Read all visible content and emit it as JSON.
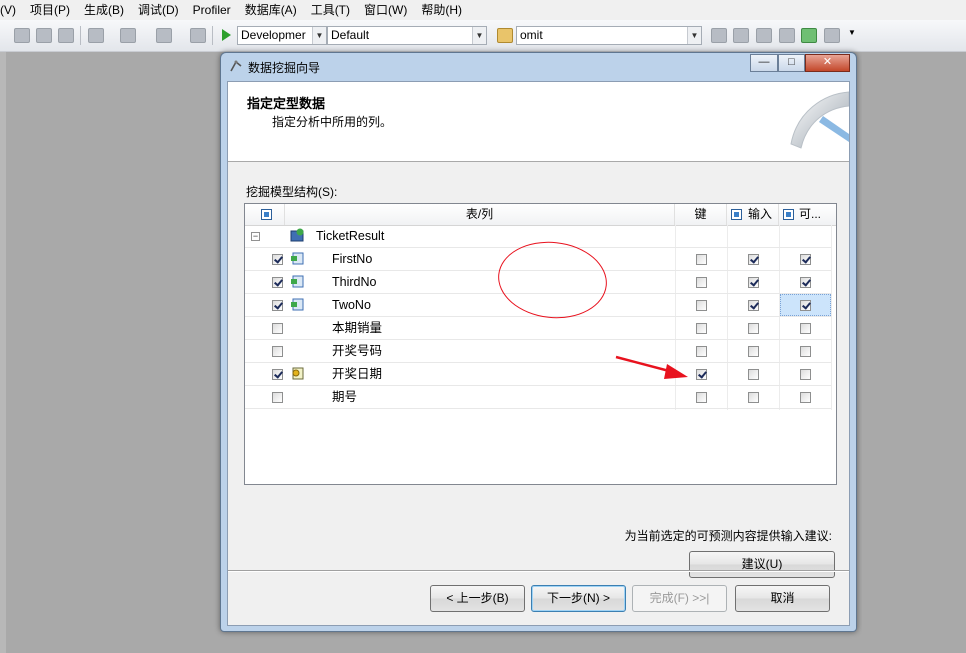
{
  "menu": [
    "(V)",
    "项目(P)",
    "生成(B)",
    "调试(D)",
    "Profiler",
    "数据库(A)",
    "工具(T)",
    "窗口(W)",
    "帮助(H)"
  ],
  "toolbar": {
    "config_combo": "Developmer",
    "platform_combo": "Default",
    "find_combo": "omit"
  },
  "dialog": {
    "title": "数据挖掘向导",
    "header_title": "指定定型数据",
    "header_subtitle": "指定分析中所用的列。",
    "structure_label": "挖掘模型结构(S):",
    "grid": {
      "columns": [
        "表/列",
        "键",
        "输入",
        "可..."
      ],
      "root": "TicketResult",
      "rows": [
        {
          "name": "FirstNo",
          "include": true,
          "icon": "numeric-column-icon",
          "key": false,
          "input": true,
          "predict": true
        },
        {
          "name": "ThirdNo",
          "include": true,
          "icon": "numeric-column-icon",
          "key": false,
          "input": true,
          "predict": true
        },
        {
          "name": "TwoNo",
          "include": true,
          "icon": "numeric-column-icon",
          "key": false,
          "input": true,
          "predict": true
        },
        {
          "name": "本期销量",
          "include": false,
          "icon": "",
          "key": false,
          "input": false,
          "predict": false
        },
        {
          "name": "开奖号码",
          "include": false,
          "icon": "",
          "key": false,
          "input": false,
          "predict": false
        },
        {
          "name": "开奖日期",
          "include": true,
          "icon": "date-key-column-icon",
          "key": true,
          "input": false,
          "predict": false
        },
        {
          "name": "期号",
          "include": false,
          "icon": "",
          "key": false,
          "input": false,
          "predict": false
        }
      ]
    },
    "suggest_text": "为当前选定的可预测内容提供输入建议:",
    "suggest_button": "建议(U)",
    "buttons": {
      "back": "< 上一步(B)",
      "next": "下一步(N) >",
      "finish": "完成(F) >>|",
      "cancel": "取消"
    },
    "window_buttons": {
      "minimize": "—",
      "maximize": "□",
      "close": "✕"
    }
  },
  "colors": {
    "annotation": "#e8121e",
    "dialog_frame": "#bcd2ea",
    "selection": "#cce4fb"
  }
}
